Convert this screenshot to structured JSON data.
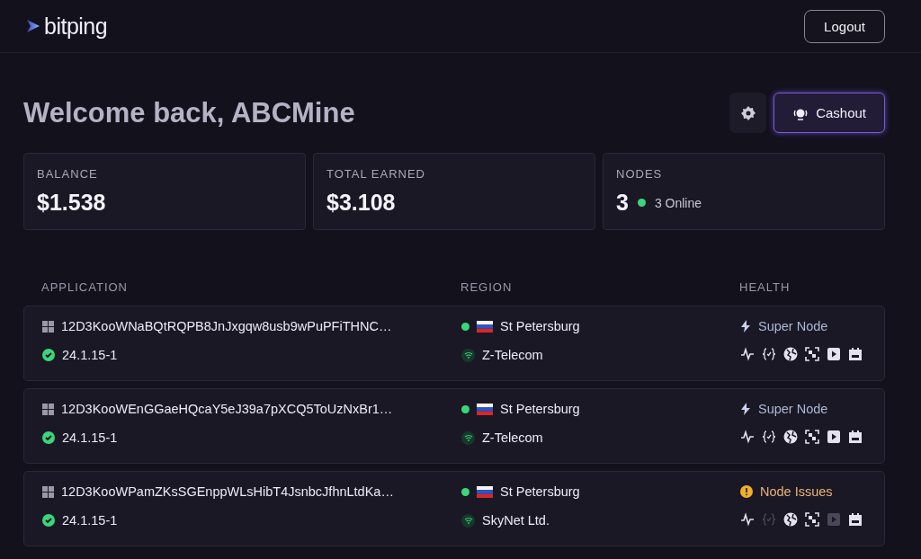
{
  "header": {
    "logo": "bitping",
    "logout": "Logout"
  },
  "welcome": "Welcome back, ABCMine",
  "cashout": "Cashout",
  "stats": [
    {
      "label": "BALANCE",
      "value": "$1.538"
    },
    {
      "label": "TOTAL EARNED",
      "value": "$3.108"
    },
    {
      "label": "NODES",
      "value": "3",
      "online": "3 Online"
    }
  ],
  "table": {
    "columns": [
      "APPLICATION",
      "REGION",
      "HEALTH"
    ],
    "rows": [
      {
        "node_id": "12D3KooWNaBQtRQPB8JnJxgqw8usb9wPuPFiTHNC…",
        "version": "24.1.15-1",
        "city": "St Petersburg",
        "isp": "Z-Telecom",
        "health": {
          "kind": "super",
          "label": "Super Node"
        },
        "capabilities": [
          {
            "kind": "pulse",
            "enabled": true
          },
          {
            "kind": "code",
            "enabled": true
          },
          {
            "kind": "globe",
            "enabled": true
          },
          {
            "kind": "scan",
            "enabled": true
          },
          {
            "kind": "play",
            "enabled": true
          },
          {
            "kind": "box",
            "enabled": true
          }
        ]
      },
      {
        "node_id": "12D3KooWEnGGaeHQcaY5eJ39a7pXCQ5ToUzNxBr1…",
        "version": "24.1.15-1",
        "city": "St Petersburg",
        "isp": "Z-Telecom",
        "health": {
          "kind": "super",
          "label": "Super Node"
        },
        "capabilities": [
          {
            "kind": "pulse",
            "enabled": true
          },
          {
            "kind": "code",
            "enabled": true
          },
          {
            "kind": "globe",
            "enabled": true
          },
          {
            "kind": "scan",
            "enabled": true
          },
          {
            "kind": "play",
            "enabled": true
          },
          {
            "kind": "box",
            "enabled": true
          }
        ]
      },
      {
        "node_id": "12D3KooWPamZKsSGEnppWLsHibT4JsnbcJfhnLtdKa…",
        "version": "24.1.15-1",
        "city": "St Petersburg",
        "isp": "SkyNet Ltd.",
        "health": {
          "kind": "issues",
          "label": "Node Issues"
        },
        "capabilities": [
          {
            "kind": "pulse",
            "enabled": true
          },
          {
            "kind": "code",
            "enabled": false
          },
          {
            "kind": "globe",
            "enabled": true
          },
          {
            "kind": "scan",
            "enabled": true
          },
          {
            "kind": "play",
            "enabled": false
          },
          {
            "kind": "box",
            "enabled": true
          }
        ]
      }
    ]
  }
}
